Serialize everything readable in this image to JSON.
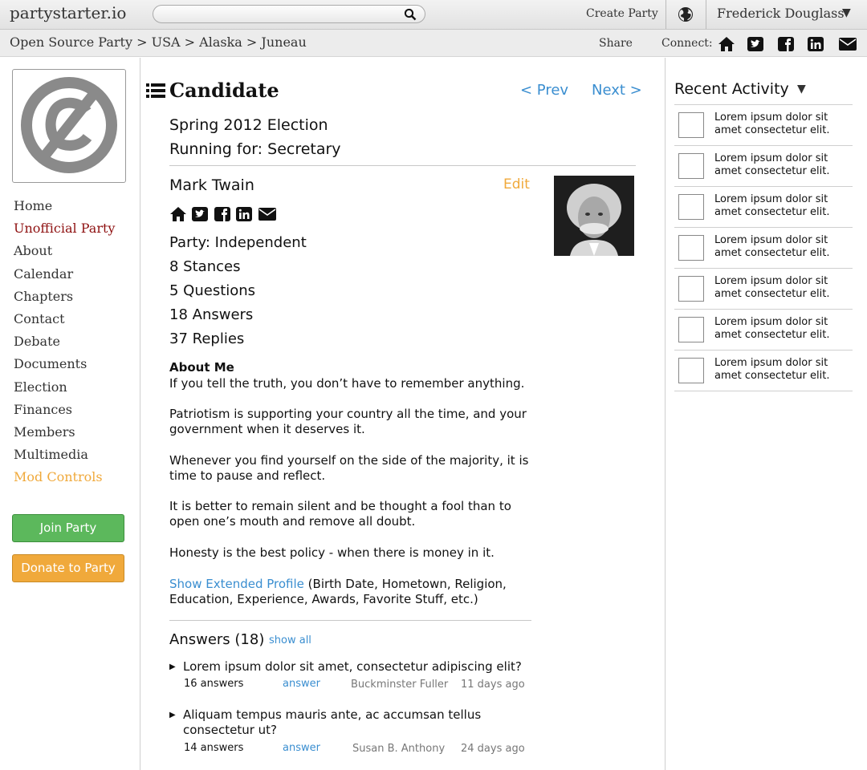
{
  "topbar": {
    "logo": "partystarter.io",
    "search_placeholder": "",
    "create_party": "Create Party",
    "user_name": "Frederick Douglass",
    "user_caret": "▼"
  },
  "breadcrumb": {
    "items": [
      "Open Source Party",
      "USA",
      "Alaska",
      "Juneau"
    ],
    "separator": ">",
    "share": "Share",
    "connect": "Connect:"
  },
  "sidebar": {
    "nav": [
      "Home",
      "Unofficial Party",
      "About",
      "Calendar",
      "Chapters",
      "Contact",
      "Debate",
      "Documents",
      "Election",
      "Finances",
      "Members",
      "Multimedia",
      "Mod Controls"
    ],
    "active_item": "Unofficial Party",
    "join_button": "Join Party",
    "donate_button": "Donate to Party"
  },
  "main": {
    "title": "Candidate",
    "prev": "< Prev",
    "next": "Next >",
    "election": "Spring 2012 Election",
    "running_for": "Running for: Secretary",
    "candidate_name": "Mark Twain",
    "edit": "Edit",
    "stats": [
      "Party: Independent",
      "8 Stances",
      "5 Questions",
      "18 Answers",
      "37 Replies"
    ],
    "about_heading": "About Me",
    "about_paragraphs": [
      "If you tell the truth, you don’t have to remember anything.",
      "Patriotism is supporting your country all the time, and your government when it deserves it.",
      "Whenever you find yourself on the side of the majority, it is time to pause and reflect.",
      "It is better to remain silent and be thought a fool than to open one’s mouth and remove all doubt.",
      "Honesty is the best policy - when there is money in it."
    ],
    "show_extended": "Show Extended Profile",
    "extended_note": " (Birth Date, Hometown, Religion, Education, Experience,  Awards, Favorite Stuff, etc.)",
    "answers_heading": "Answers (18)",
    "show_all": "show all",
    "questions": [
      {
        "text": "Lorem ipsum dolor sit amet, consectetur adipiscing elit?",
        "count": "16 answers",
        "answer": "answer",
        "author": "Buckminster Fuller",
        "time": "11 days ago"
      },
      {
        "text": "Aliquam tempus mauris ante, ac accumsan tellus consectetur ut?",
        "count": "14 answers",
        "answer": "answer",
        "author": "Susan B. Anthony",
        "time": "24 days ago"
      }
    ]
  },
  "recent_activity": {
    "title": "Recent Activity",
    "caret": "▼",
    "items": [
      "Lorem ipsum dolor sit amet consectetur elit.",
      "Lorem ipsum dolor sit amet consectetur elit.",
      "Lorem ipsum dolor sit amet consectetur elit.",
      "Lorem ipsum dolor sit amet consectetur elit.",
      "Lorem ipsum dolor sit amet consectetur elit.",
      "Lorem ipsum dolor sit amet consectetur elit.",
      "Lorem ipsum dolor sit amet consectetur elit."
    ]
  },
  "icons": {
    "connect": [
      "home-icon",
      "twitter-icon",
      "facebook-icon",
      "linkedin-icon",
      "envelope-icon"
    ],
    "candidate": [
      "home-icon",
      "twitter-icon",
      "facebook-icon",
      "linkedin-icon",
      "envelope-icon"
    ]
  },
  "colors": {
    "link_blue": "#3a8ed0",
    "orange": "#f0a93b",
    "active_red": "#8e1010",
    "join_green": "#5cb85c"
  }
}
